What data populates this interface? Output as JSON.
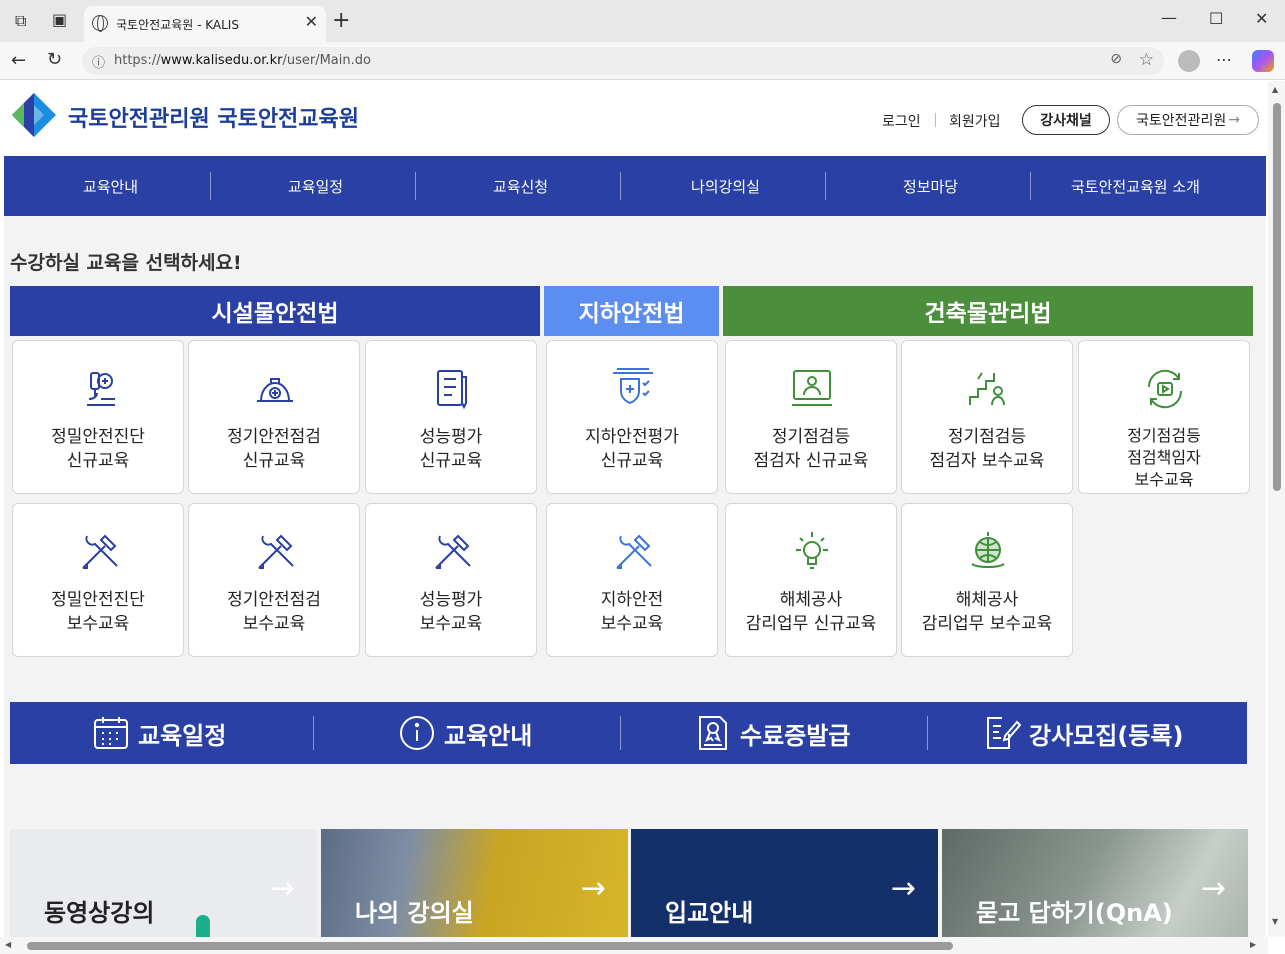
{
  "browser": {
    "tab_title": "국토안전교육원 - KALIS",
    "url_prefix": "https://",
    "url_domain": "www.kalisedu.or.kr",
    "url_path": "/user/Main.do"
  },
  "header": {
    "title": "국토안전관리원 국토안전교육원",
    "login": "로그인",
    "signup": "회원가입",
    "instructor_channel": "강사채널",
    "kalis_link": "국토안전관리원"
  },
  "gnb": [
    "교육안내",
    "교육일정",
    "교육신청",
    "나의강의실",
    "정보마당",
    "국토안전교육원 소개"
  ],
  "main": {
    "prompt": "수강하실 교육을 선택하세요!",
    "categories": [
      {
        "label": "시설물안전법",
        "color": "#2a40a4"
      },
      {
        "label": "지하안전법",
        "color": "#5b8ef0"
      },
      {
        "label": "건축물관리법",
        "color": "#4b8f3d"
      }
    ],
    "row1": [
      {
        "l1": "정밀안전진단",
        "l2": "신규교육",
        "icon": "microscope-icon"
      },
      {
        "l1": "정기안전점검",
        "l2": "신규교육",
        "icon": "hardhat-icon"
      },
      {
        "l1": "성능평가",
        "l2": "신규교육",
        "icon": "document-pen-icon"
      },
      {
        "l1": "지하안전평가",
        "l2": "신규교육",
        "icon": "shield-check-icon"
      },
      {
        "l1": "정기점검등",
        "l2": "점검자 신규교육",
        "icon": "monitor-person-icon"
      },
      {
        "l1": "정기점검등",
        "l2": "점검자 보수교육",
        "icon": "stairs-person-icon"
      },
      {
        "l1": "정기점검등",
        "l2": "점검책임자",
        "l3": "보수교육",
        "icon": "refresh-play-icon"
      }
    ],
    "row2": [
      {
        "l1": "정밀안전진단",
        "l2": "보수교육",
        "icon": "tools-icon"
      },
      {
        "l1": "정기안전점검",
        "l2": "보수교육",
        "icon": "tools-icon"
      },
      {
        "l1": "성능평가",
        "l2": "보수교육",
        "icon": "tools-icon"
      },
      {
        "l1": "지하안전",
        "l2": "보수교육",
        "icon": "tools-icon"
      },
      {
        "l1": "해체공사",
        "l2": "감리업무 신규교육",
        "icon": "lightbulb-icon"
      },
      {
        "l1": "해체공사",
        "l2": "감리업무 보수교육",
        "icon": "globe-hand-icon"
      }
    ]
  },
  "quick": [
    "교육일정",
    "교육안내",
    "수료증발급",
    "강사모집(등록)"
  ],
  "banners": [
    "동영상강의",
    "나의 강의실",
    "입교안내",
    "묻고 답하기(QnA)"
  ],
  "colors": {
    "primary": "#2a40a4",
    "sky": "#5b8ef0",
    "green": "#4b8f3d"
  }
}
